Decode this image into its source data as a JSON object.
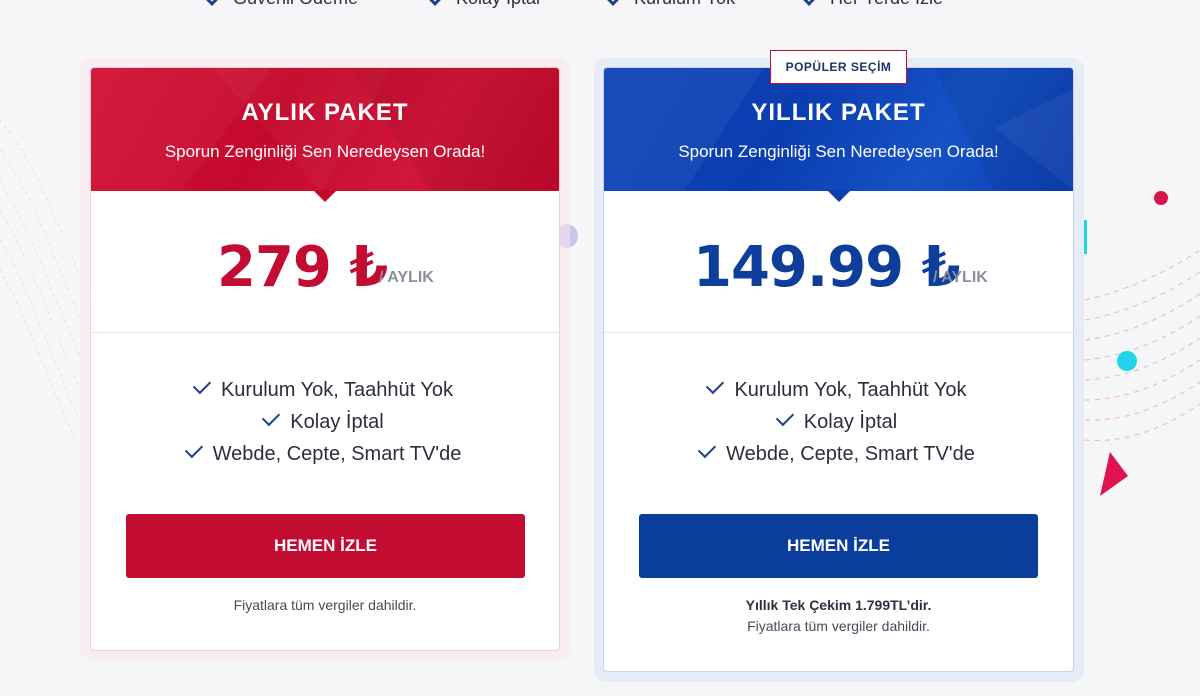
{
  "top_features": [
    "Güvenli Ödeme",
    "Kolay İptal",
    "Kurulum Yok",
    "Her Yerde İzle"
  ],
  "colors": {
    "red": "#c20c32",
    "blue": "#0b3d9c",
    "accent_cyan": "#19d3e8",
    "accent_magenta": "#e0124f"
  },
  "plans": {
    "monthly": {
      "title": "AYLIK PAKET",
      "subtitle": "Sporun Zenginliği Sen Neredeysen Orada!",
      "price": "279",
      "currency": "₺",
      "period": "/ AYLIK",
      "features": [
        "Kurulum Yok, Taahhüt Yok",
        "Kolay İptal",
        "Webde, Cepte, Smart TV'de"
      ],
      "button": "HEMEN İZLE",
      "note": "Fiyatlara tüm vergiler dahildir."
    },
    "yearly": {
      "badge": "POPÜLER SEÇİM",
      "title": "YILLIK PAKET",
      "subtitle": "Sporun Zenginliği Sen Neredeysen Orada!",
      "price": "149.99",
      "currency": "₺",
      "period": "/ AYLIK",
      "features": [
        "Kurulum Yok, Taahhüt Yok",
        "Kolay İptal",
        "Webde, Cepte, Smart TV'de"
      ],
      "button": "HEMEN İZLE",
      "note_bold": "Yıllık Tek Çekim 1.799TL’dir.",
      "note": "Fiyatlara tüm vergiler dahildir."
    }
  }
}
